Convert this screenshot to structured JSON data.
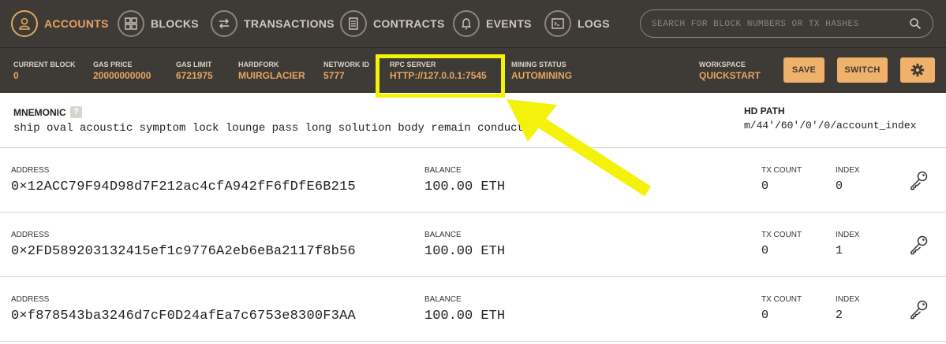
{
  "nav": {
    "items": [
      {
        "label": "ACCOUNTS",
        "icon": "person-icon",
        "active": true
      },
      {
        "label": "BLOCKS",
        "icon": "grid-icon",
        "active": false
      },
      {
        "label": "TRANSACTIONS",
        "icon": "swap-arrows-icon",
        "active": false
      },
      {
        "label": "CONTRACTS",
        "icon": "document-icon",
        "active": false
      },
      {
        "label": "EVENTS",
        "icon": "bell-icon",
        "active": false
      },
      {
        "label": "LOGS",
        "icon": "terminal-icon",
        "active": false
      }
    ],
    "search_placeholder": "SEARCH FOR BLOCK NUMBERS OR TX HASHES"
  },
  "status": {
    "current_block": {
      "label": "CURRENT BLOCK",
      "value": "0"
    },
    "gas_price": {
      "label": "GAS PRICE",
      "value": "20000000000"
    },
    "gas_limit": {
      "label": "GAS LIMIT",
      "value": "6721975"
    },
    "hardfork": {
      "label": "HARDFORK",
      "value": "MUIRGLACIER"
    },
    "network_id": {
      "label": "NETWORK ID",
      "value": "5777"
    },
    "rpc_server": {
      "label": "RPC SERVER",
      "value": "HTTP://127.0.0.1:7545"
    },
    "mining_status": {
      "label": "MINING STATUS",
      "value": "AUTOMINING"
    },
    "workspace": {
      "label": "WORKSPACE",
      "value": "QUICKSTART"
    },
    "save_label": "SAVE",
    "switch_label": "SWITCH"
  },
  "mnemonic": {
    "title": "MNEMONIC",
    "help": "?",
    "words": "ship oval acoustic symptom lock lounge pass long solution body remain conduct",
    "hd_path_title": "HD PATH",
    "hd_path": "m/44'/60'/0'/0/account_index"
  },
  "account_labels": {
    "address": "ADDRESS",
    "balance": "BALANCE",
    "tx_count": "TX COUNT",
    "index": "INDEX"
  },
  "accounts": [
    {
      "address": "0×12ACC79F94D98d7F212ac4cfA942fF6fDfE6B215",
      "balance": "100.00 ETH",
      "tx_count": "0",
      "index": "0"
    },
    {
      "address": "0×2FD589203132415ef1c9776A2eb6eBa2117f8b56",
      "balance": "100.00 ETH",
      "tx_count": "0",
      "index": "1"
    },
    {
      "address": "0×f878543ba3246d7cF0D24afEa7c6753e8300F3AA",
      "balance": "100.00 ETH",
      "tx_count": "0",
      "index": "2"
    }
  ],
  "colors": {
    "nav_bg": "#3e3a35",
    "accent": "#e4a663",
    "button_bg": "#f0b26b",
    "highlight": "#f4f10b"
  }
}
